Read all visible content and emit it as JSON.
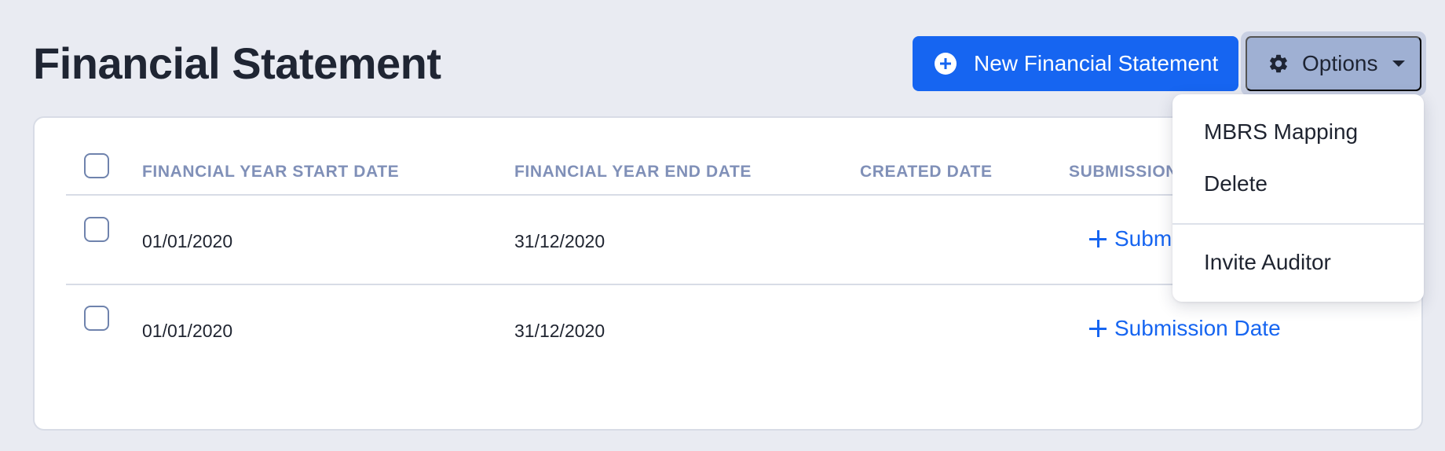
{
  "header": {
    "title": "Financial Statement",
    "new_button_label": "New Financial Statement",
    "options_button_label": "Options"
  },
  "table": {
    "columns": [
      "FINANCIAL YEAR START DATE",
      "FINANCIAL YEAR END DATE",
      "CREATED DATE",
      "SUBMISSION"
    ],
    "rows": [
      {
        "start": "01/01/2020",
        "end": "31/12/2020",
        "created": "",
        "submission_action": "Submi"
      },
      {
        "start": "01/01/2020",
        "end": "31/12/2020",
        "created": "",
        "submission_action": "Submission Date"
      }
    ]
  },
  "dropdown": {
    "items": [
      "MBRS Mapping",
      "Delete",
      "Invite Auditor"
    ]
  },
  "colors": {
    "primary": "#1665f1",
    "options_bg": "#9fb0d3",
    "page_bg": "#e9ebf2",
    "header_text": "#8090b8"
  },
  "icons": {
    "new_button": "plus-circle-icon",
    "options_button": "gear-icon",
    "options_caret": "caret-down-icon",
    "submission_link": "plus-icon"
  }
}
